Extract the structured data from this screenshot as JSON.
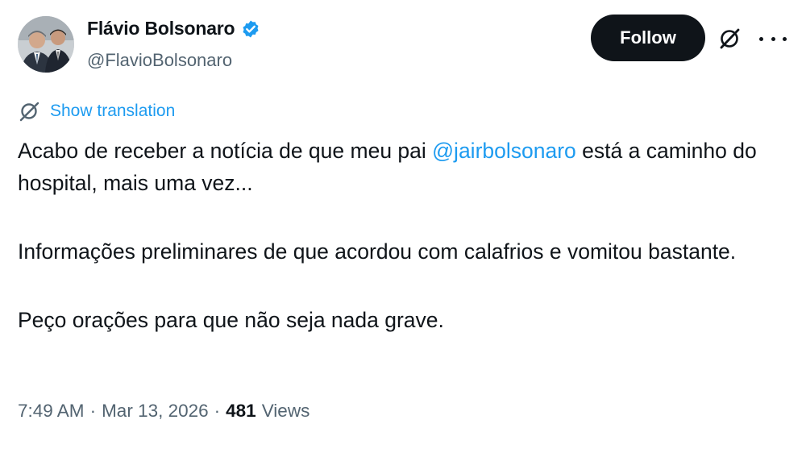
{
  "author": {
    "name": "Flávio Bolsonaro",
    "handle": "@FlavioBolsonaro",
    "verified": true,
    "verified_color": "#1d9bf0"
  },
  "actions": {
    "follow_label": "Follow"
  },
  "icons": {
    "grok": "grok-icon",
    "more": "more-icon",
    "translate": "translate-icon",
    "verified": "verified-badge-icon"
  },
  "translation": {
    "label": "Show translation"
  },
  "tweet": {
    "p1_before": "Acabo de receber a notícia de que meu pai ",
    "mention": "@jairbolsonaro",
    "p1_after": " está a caminho do hospital, mais uma vez...",
    "p2": "Informações preliminares de que acordou com calafrios e vomitou bastante.",
    "p3": "Peço orações para que não seja nada grave."
  },
  "meta": {
    "time": "7:49 AM",
    "sep1": "·",
    "date": "Mar 13, 2026",
    "sep2": "·",
    "views_count": "481",
    "views_label": "Views"
  },
  "colors": {
    "accent": "#1d9bf0",
    "text": "#0f1419",
    "secondary": "#536471",
    "button_bg": "#0f1419"
  }
}
